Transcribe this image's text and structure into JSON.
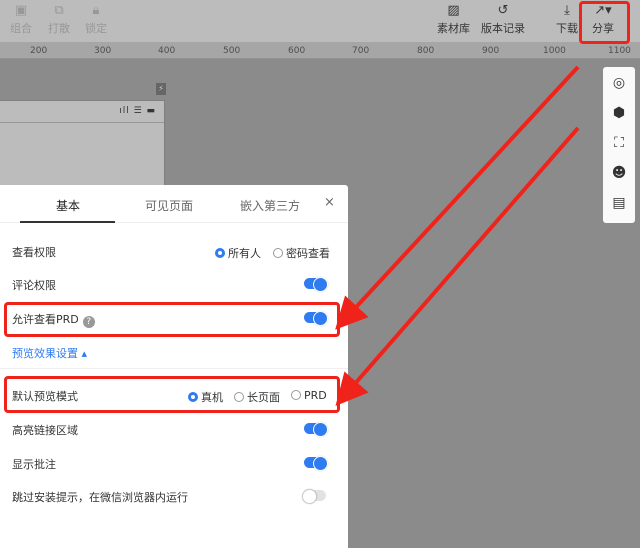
{
  "toolbar": {
    "left": [
      {
        "label": "组合",
        "icon": "group-icon"
      },
      {
        "label": "打散",
        "icon": "ungroup-icon"
      },
      {
        "label": "锁定",
        "icon": "lock-icon"
      }
    ],
    "right": [
      {
        "label": "素材库",
        "icon": "image-library-icon"
      },
      {
        "label": "版本记录",
        "icon": "history-icon"
      },
      {
        "label": "下载",
        "icon": "download-icon"
      },
      {
        "label": "分享",
        "icon": "share-icon"
      }
    ]
  },
  "ruler": {
    "ticks": [
      "200",
      "300",
      "400",
      "500",
      "600",
      "700",
      "800",
      "900",
      "1000",
      "1100"
    ]
  },
  "phone": {
    "status_icons": "ıll ☰ ▬"
  },
  "dialog": {
    "tabs": [
      "基本",
      "可见页面",
      "嵌入第三方"
    ],
    "active_tab": "基本",
    "close": "×",
    "view_permission": {
      "label": "查看权限",
      "options": [
        "所有人",
        "密码查看"
      ],
      "selected": "所有人"
    },
    "comment_permission": {
      "label": "评论权限",
      "enabled": true
    },
    "allow_prd": {
      "label": "允许查看PRD",
      "help": "?",
      "enabled": true
    },
    "preview_settings_link": "预览效果设置 ▴",
    "default_mode": {
      "label": "默认预览模式",
      "options": [
        "真机",
        "长页面",
        "PRD"
      ],
      "selected": "真机"
    },
    "highlight_links": {
      "label": "高亮链接区域",
      "enabled": true
    },
    "show_comments": {
      "label": "显示批注",
      "enabled": true
    },
    "skip_install": {
      "label": "跳过安装提示，在微信浏览器内运行",
      "enabled": false
    }
  },
  "colors": {
    "accent": "#2f7bf0",
    "highlight": "#f0231b"
  }
}
